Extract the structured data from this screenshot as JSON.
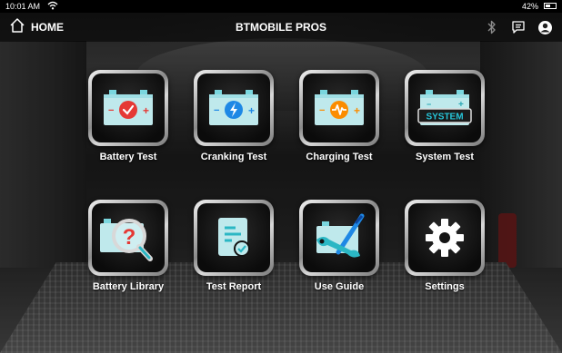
{
  "status_bar": {
    "time": "10:01 AM",
    "battery_percent": "42%",
    "battery_level": 0.42,
    "icons": [
      "wifi-icon",
      "battery-icon"
    ]
  },
  "header": {
    "home_label": "HOME",
    "title": "BTMOBILE PROS",
    "icons": [
      "home-icon",
      "bluetooth-icon",
      "message-icon",
      "account-icon"
    ]
  },
  "tiles": [
    {
      "label": "Battery Test",
      "icon": "battery-test-icon",
      "accent": "#e53935"
    },
    {
      "label": "Cranking Test",
      "icon": "cranking-test-icon",
      "accent": "#1e88e5"
    },
    {
      "label": "Charging Test",
      "icon": "charging-test-icon",
      "accent": "#fb8c00"
    },
    {
      "label": "System Test",
      "icon": "system-test-icon",
      "icon_text": "SYSTEM",
      "accent": "#26c6da"
    },
    {
      "label": "Battery Library",
      "icon": "battery-library-icon",
      "accent": "#e53935"
    },
    {
      "label": "Test Report",
      "icon": "test-report-icon",
      "accent": "#26c6da"
    },
    {
      "label": "Use Guide",
      "icon": "use-guide-icon",
      "accent": "#1e88e5"
    },
    {
      "label": "Settings",
      "icon": "gear-icon",
      "accent": "#ffffff"
    }
  ],
  "colors": {
    "battery_body": "#bfe9ec",
    "battery_terminal": "#7ad6de"
  }
}
